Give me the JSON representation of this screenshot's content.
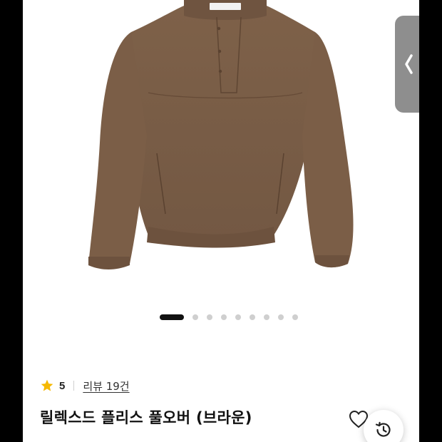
{
  "product": {
    "title": "릴렉스드 플리스 풀오버 (브라운)",
    "image_name": "brown-fleece-pullover",
    "carousel": {
      "total": 9,
      "active_index": 0
    }
  },
  "rating": {
    "score": "5",
    "review_link": "리뷰 19건"
  },
  "colors": {
    "garment": "#8a6b52",
    "star": "#f5b800",
    "side_tab": "#8e8e8e"
  },
  "icons": {
    "star": "star-icon",
    "heart": "heart-icon",
    "history": "history-icon",
    "side_tab": "chevron-left-icon"
  }
}
